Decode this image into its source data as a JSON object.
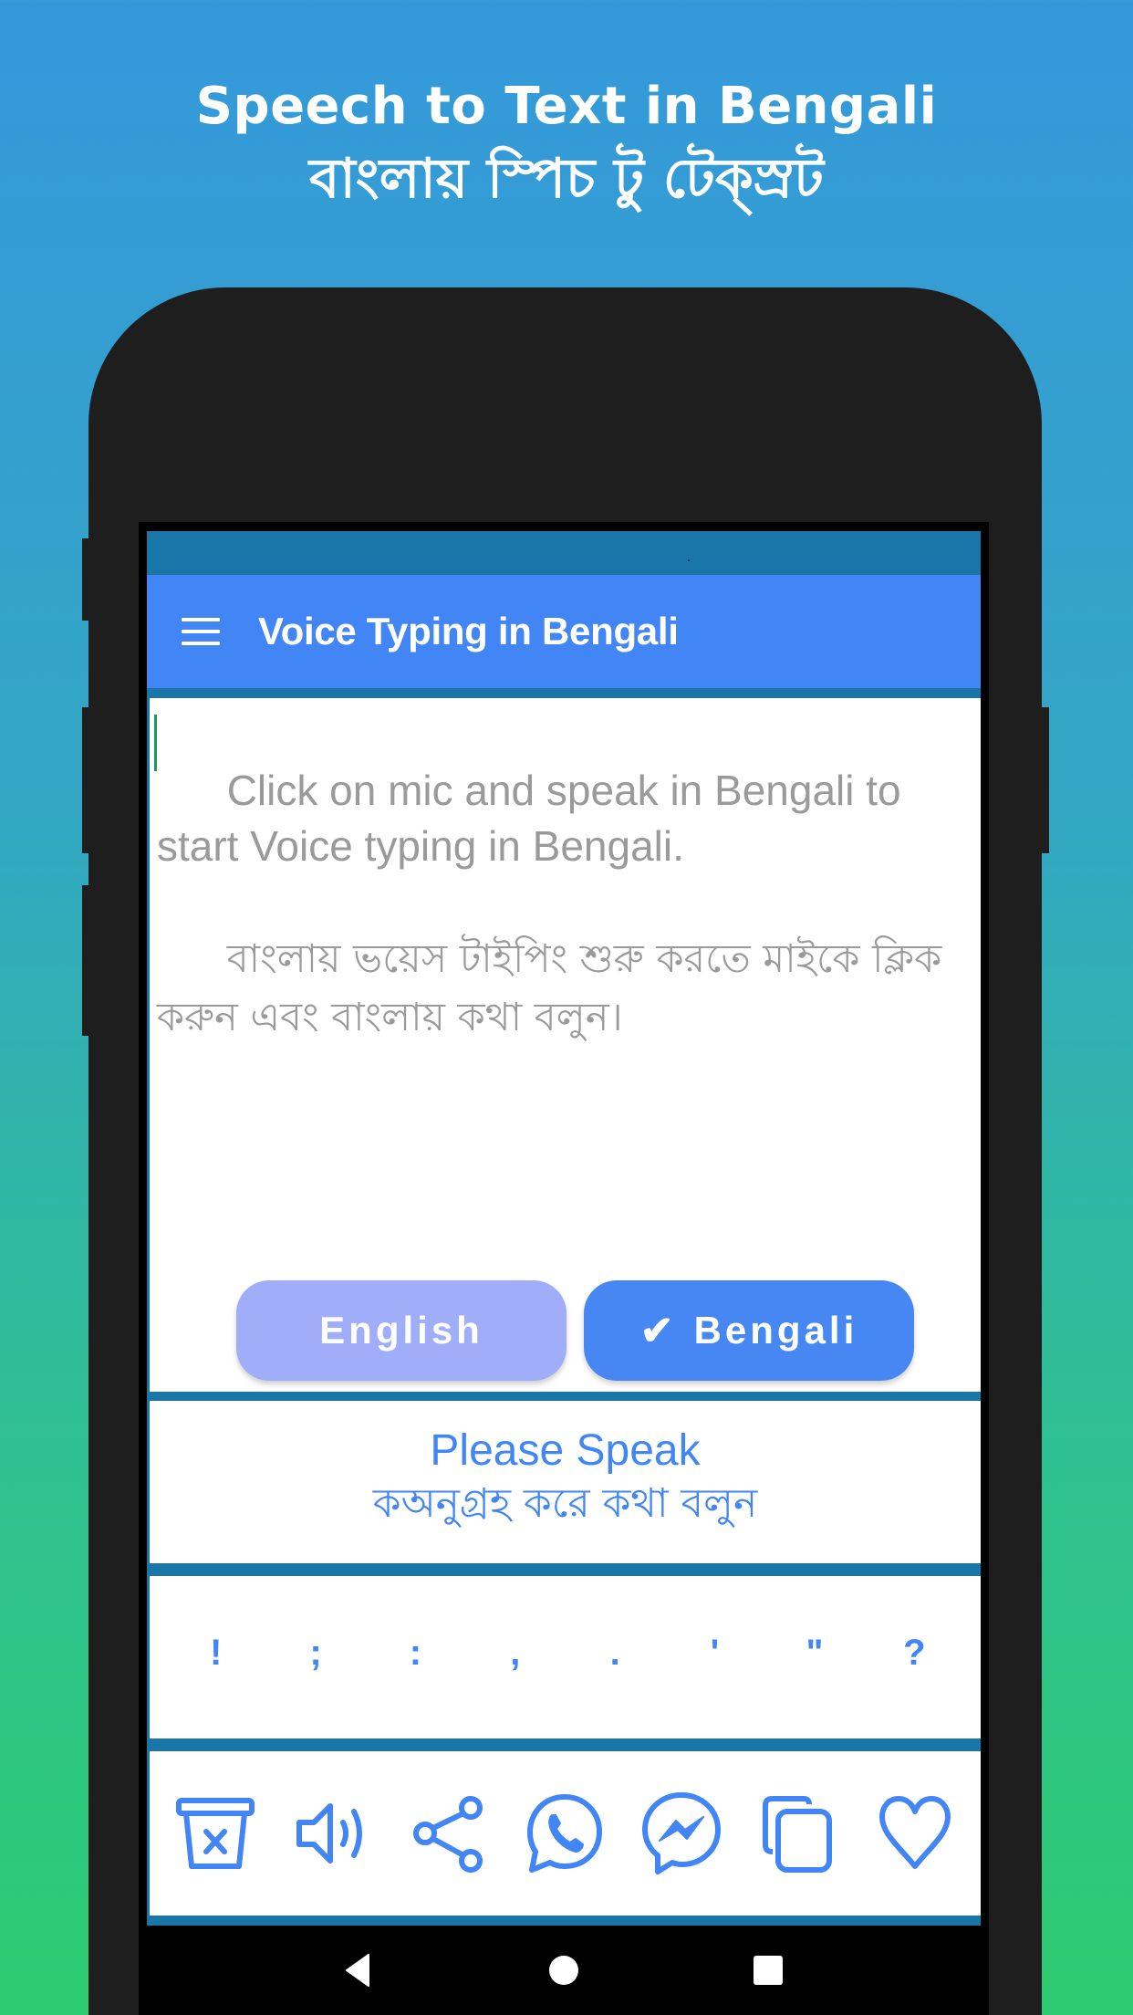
{
  "promo": {
    "title_en": "Speech to Text in Bengali",
    "title_bn": "বাংলায় স্পিচ টু টেক্স্রট"
  },
  "app": {
    "title": "Voice Typing in Bengali",
    "menu_icon": "hamburger-menu-icon"
  },
  "editor": {
    "placeholder_en": "Click on mic and speak in Bengali to start Voice typing in Bengali.",
    "placeholder_bn": "বাংলায় ভয়েস টাইপিং শুরু করতে মাইকে ক্লিক করুন এবং বাংলায় কথা বলুন।",
    "value": ""
  },
  "languages": {
    "english_label": "English",
    "bengali_label": "Bengali",
    "selected": "Bengali",
    "check_mark": "✔",
    "colors": {
      "active": "#4687f4",
      "inactive": "#a0aef9"
    }
  },
  "status": {
    "line_en": "Please Speak",
    "line_bn": "কঅনুগ্রহ করে কথা বলুন"
  },
  "punctuation": [
    "!",
    ";",
    ":",
    ",",
    ".",
    "'",
    "\"",
    "?"
  ],
  "toolbar": [
    {
      "icon": "clear-text-icon",
      "label": "Clear"
    },
    {
      "icon": "speaker-icon",
      "label": "Speak"
    },
    {
      "icon": "share-icon",
      "label": "Share"
    },
    {
      "icon": "whatsapp-icon",
      "label": "WhatsApp"
    },
    {
      "icon": "messenger-icon",
      "label": "Messenger"
    },
    {
      "icon": "copy-icon",
      "label": "Copy"
    },
    {
      "icon": "favorite-icon",
      "label": "Favorite"
    }
  ],
  "nav": [
    "back-icon",
    "home-icon",
    "recents-icon"
  ],
  "colors": {
    "accent": "#4285f4",
    "status_bar": "#1976a8",
    "placeholder_text": "#9a9a9a",
    "bg_top": "#3498db",
    "bg_bottom": "#2ecc71"
  }
}
